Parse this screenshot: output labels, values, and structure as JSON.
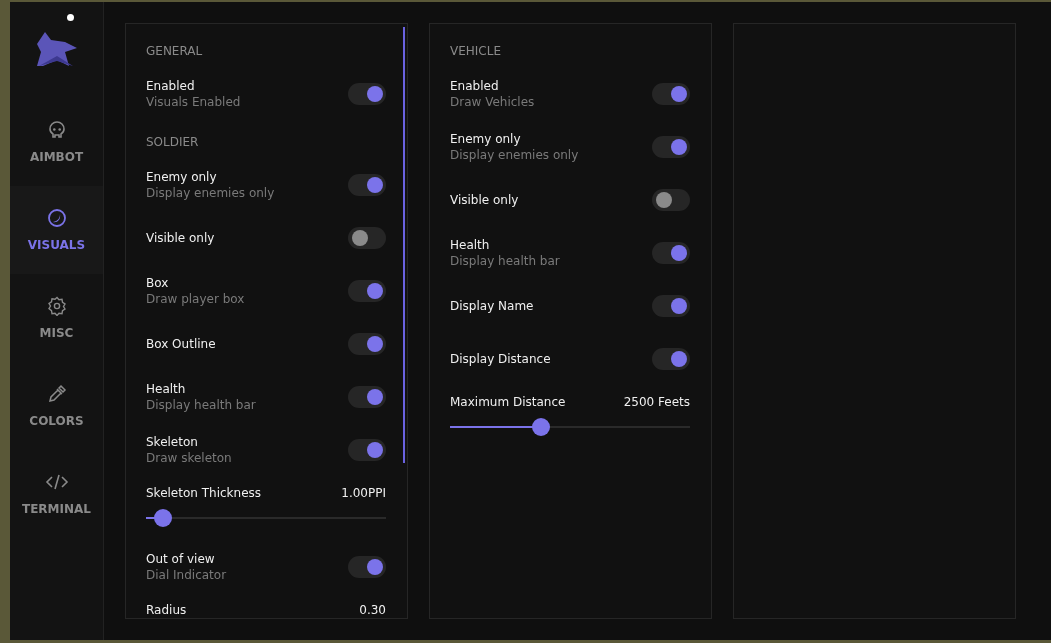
{
  "sidebar": {
    "items": [
      {
        "label": "AIMBOT",
        "selected": false
      },
      {
        "label": "VISUALS",
        "selected": true
      },
      {
        "label": "MISC",
        "selected": false
      },
      {
        "label": "COLORS",
        "selected": false
      },
      {
        "label": "TERMINAL",
        "selected": false
      }
    ]
  },
  "panels": [
    {
      "items": [
        {
          "kind": "header",
          "label": "GENERAL"
        },
        {
          "kind": "toggle",
          "label": "Enabled",
          "description": "Visuals Enabled",
          "on": true
        },
        {
          "kind": "header",
          "label": "SOLDIER"
        },
        {
          "kind": "toggle",
          "label": "Enemy only",
          "description": "Display enemies only",
          "on": true
        },
        {
          "kind": "toggle",
          "label": "Visible only",
          "on": false
        },
        {
          "kind": "toggle",
          "label": "Box",
          "description": "Draw player box",
          "on": true
        },
        {
          "kind": "toggle",
          "label": "Box Outline",
          "on": true
        },
        {
          "kind": "toggle",
          "label": "Health",
          "description": "Display health bar",
          "on": true
        },
        {
          "kind": "toggle",
          "label": "Skeleton",
          "description": "Draw skeleton",
          "on": true
        },
        {
          "kind": "slider",
          "label": "Skeleton Thickness",
          "value": "1.00PPI",
          "level": 0.07
        },
        {
          "kind": "toggle",
          "label": "Out of view",
          "description": "Dial Indicator",
          "on": true
        },
        {
          "kind": "slider",
          "label": "Radius",
          "value": "0.30"
        }
      ]
    },
    {
      "items": [
        {
          "kind": "header",
          "label": "VEHICLE"
        },
        {
          "kind": "toggle",
          "label": "Enabled",
          "description": "Draw Vehicles",
          "on": true
        },
        {
          "kind": "toggle",
          "label": "Enemy only",
          "description": "Display enemies only",
          "on": true
        },
        {
          "kind": "toggle",
          "label": "Visible only",
          "on": false
        },
        {
          "kind": "toggle",
          "label": "Health",
          "description": "Display health bar",
          "on": true
        },
        {
          "kind": "toggle",
          "label": "Display Name",
          "on": true
        },
        {
          "kind": "toggle",
          "label": "Display Distance",
          "on": true
        },
        {
          "kind": "slider",
          "label": "Maximum Distance",
          "value": "2500 Feets",
          "level": 0.38
        }
      ]
    }
  ]
}
